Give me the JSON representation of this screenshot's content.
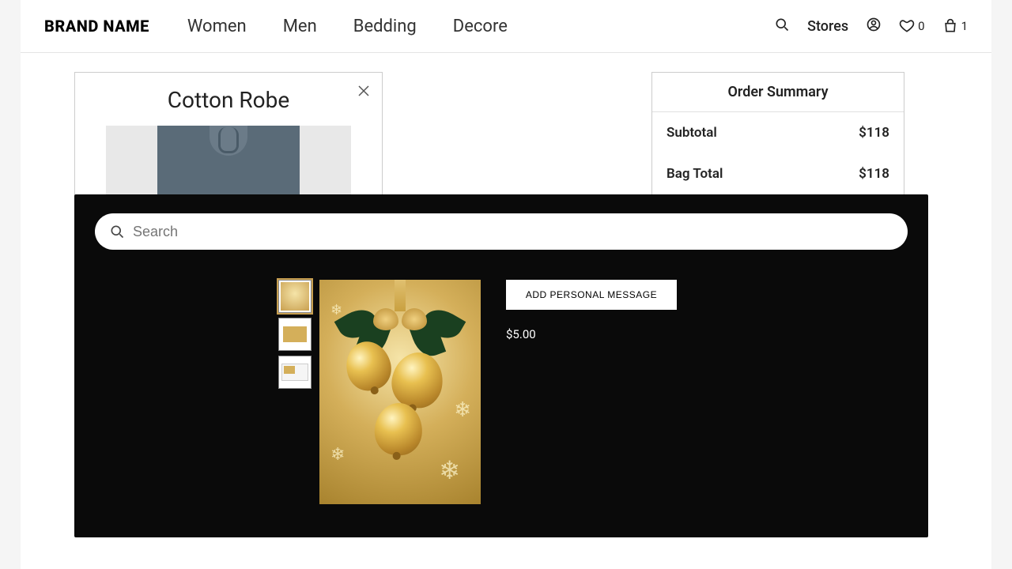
{
  "header": {
    "logo": "BRAND NAME",
    "nav": [
      "Women",
      "Men",
      "Bedding",
      "Decore"
    ],
    "stores": "Stores",
    "wishlist_count": "0",
    "bag_count": "1"
  },
  "product": {
    "title": "Cotton Robe"
  },
  "summary": {
    "title": "Order Summary",
    "rows": [
      {
        "label": "Subtotal",
        "value": "$118"
      },
      {
        "label": "Bag Total",
        "value": "$118"
      }
    ]
  },
  "modal": {
    "search_placeholder": "Search",
    "add_message": "ADD PERSONAL MESSAGE",
    "price": "$5.00"
  }
}
